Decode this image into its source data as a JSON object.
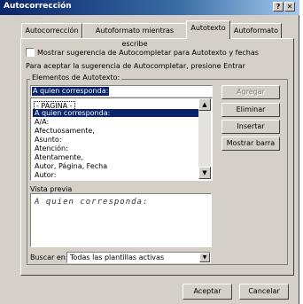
{
  "window": {
    "title": "Autocorrección",
    "help_label": "?",
    "close_label": "✕"
  },
  "tabs": [
    {
      "label": "Autocorrección",
      "active": false
    },
    {
      "label": "Autoformato mientras escribe",
      "active": false
    },
    {
      "label": "Autotexto",
      "active": true
    },
    {
      "label": "Autoformato",
      "active": false
    }
  ],
  "options": {
    "show_suggestion_label": "Mostrar sugerencia de Autocompletar para Autotexto y fechas",
    "show_suggestion_checked": false,
    "hint_text": "Para aceptar la sugerencia de Autocompletar, presione Entrar"
  },
  "autotext": {
    "group_label": "Elementos de Autotexto:",
    "input_value": "A quien corresponda:",
    "items": [
      "- PÁGINA -",
      "A quien corresponda:",
      "A/A:",
      "Afectuosamente,",
      "Asunto:",
      "Atención:",
      "Atentamente,",
      "Autor, Página, Fecha",
      "Autor:"
    ],
    "selected_index": 1
  },
  "buttons": {
    "add": "Agregar",
    "delete": "Eliminar",
    "insert": "Insertar",
    "show_toolbar": "Mostrar barra",
    "accept": "Aceptar",
    "cancel": "Cancelar"
  },
  "preview": {
    "label": "Vista previa",
    "text": "A quien corresponda:"
  },
  "lookin": {
    "label": "Buscar en:",
    "value": "Todas las plantillas activas"
  },
  "icons": {
    "scroll_up": "scroll-up-arrow-icon",
    "scroll_down": "scroll-down-arrow-icon",
    "dropdown": "dropdown-arrow-icon"
  }
}
